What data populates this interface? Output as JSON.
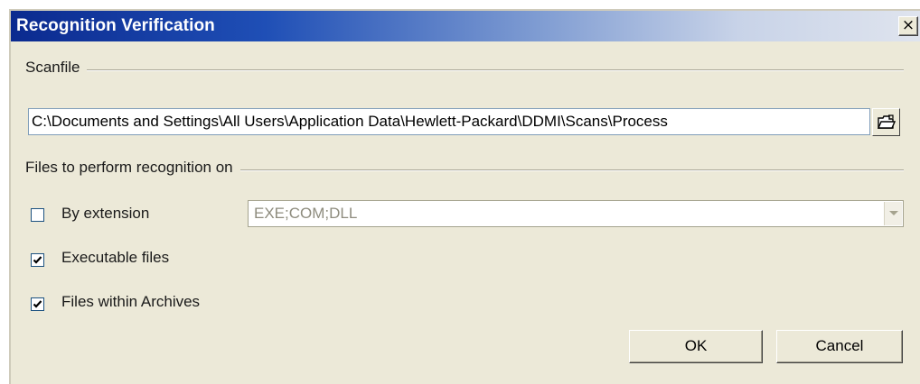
{
  "window": {
    "title": "Recognition Verification",
    "close_glyph": "×"
  },
  "scanfile": {
    "group_label": "Scanfile",
    "path_value": "C:\\Documents and Settings\\All Users\\Application Data\\Hewlett-Packard\\DDMI\\Scans\\Process",
    "browse_icon": "open-folder-icon"
  },
  "recognition": {
    "group_label": "Files to perform recognition on",
    "by_extension": {
      "label": "By extension",
      "checked": false,
      "value": "EXE;COM;DLL"
    },
    "executable_files": {
      "label": "Executable files",
      "checked": true
    },
    "archives": {
      "label": "Files within Archives",
      "checked": true
    }
  },
  "buttons": {
    "ok_label": "OK",
    "cancel_label": "Cancel"
  },
  "colors": {
    "titlebar_start": "#0b2a8f",
    "dialog_bg": "#ECE9D8",
    "disabled_text": "#8e8c7e"
  }
}
